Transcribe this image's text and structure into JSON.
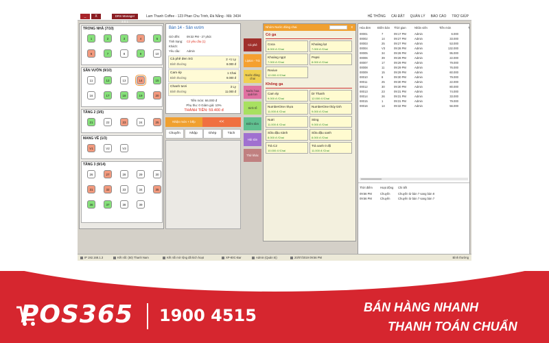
{
  "titlebar": {
    "btn1": "_",
    "btn2": "X",
    "app_title": "DRS Manager 3.0.1",
    "store": "Lam Thanh Coffee - 123 Phan Chu Trinh, Đà Nẵng - Mã: 3434"
  },
  "top_menu": [
    "HỆ THỐNG",
    "CÀI ĐẶT",
    "QUẢN LÝ",
    "BÁO CÁO",
    "TRỢ GIÚP"
  ],
  "areas": [
    {
      "title": "TRONG NHÀ  (7/10)",
      "tables": [
        {
          "n": "1",
          "c": "g"
        },
        {
          "n": "2",
          "c": "g"
        },
        {
          "n": "3",
          "c": "g"
        },
        {
          "n": "4",
          "c": "r"
        },
        {
          "n": "5",
          "c": "g"
        },
        {
          "n": "6",
          "c": "r"
        },
        {
          "n": "7",
          "c": "g"
        },
        {
          "n": "8",
          "c": ""
        },
        {
          "n": "9",
          "c": "g"
        },
        {
          "n": "10",
          "c": ""
        }
      ]
    },
    {
      "title": "SÂN VƯỜN  (9/10)",
      "tables": [
        {
          "n": "11",
          "c": ""
        },
        {
          "n": "12",
          "c": "g"
        },
        {
          "n": "13",
          "c": ""
        },
        {
          "n": "14",
          "c": "r",
          "sel": true
        },
        {
          "n": "15",
          "c": "g"
        },
        {
          "n": "16",
          "c": ""
        },
        {
          "n": "17",
          "c": "g"
        },
        {
          "n": "18",
          "c": "g"
        },
        {
          "n": "19",
          "c": "g"
        },
        {
          "n": "20",
          "c": "r"
        }
      ]
    },
    {
      "title": "TẦNG 2  (3/5)",
      "tables": [
        {
          "n": "21",
          "c": "g"
        },
        {
          "n": "22",
          "c": ""
        },
        {
          "n": "23",
          "c": "r"
        },
        {
          "n": "24",
          "c": ""
        },
        {
          "n": "25",
          "c": "r"
        }
      ]
    },
    {
      "title": "MANG VỀ  (1/3)",
      "tables": [
        {
          "n": "V1",
          "c": "r"
        },
        {
          "n": "V2",
          "c": ""
        },
        {
          "n": "V3",
          "c": ""
        }
      ]
    },
    {
      "title": "TẦNG 3  (9/14)",
      "tables": [
        {
          "n": "26",
          "c": ""
        },
        {
          "n": "27",
          "c": "r"
        },
        {
          "n": "28",
          "c": ""
        },
        {
          "n": "29",
          "c": ""
        },
        {
          "n": "30",
          "c": ""
        },
        {
          "n": "31",
          "c": "r"
        },
        {
          "n": "32",
          "c": "r"
        },
        {
          "n": "33",
          "c": ""
        },
        {
          "n": "34",
          "c": ""
        },
        {
          "n": "35",
          "c": "r"
        },
        {
          "n": "36",
          "c": "g"
        },
        {
          "n": "37",
          "c": "g"
        },
        {
          "n": "38",
          "c": ""
        },
        {
          "n": "39",
          "c": ""
        }
      ]
    }
  ],
  "info": {
    "title": "Bàn 14 - Sân vườn",
    "rows": [
      {
        "k": "Giờ đến:",
        "v": "09:32 PM  -  27 phút"
      },
      {
        "k": "Tình trạng:",
        "v": "Có yêu cầu (1)"
      },
      {
        "k": "Khách:",
        "v": ""
      },
      {
        "k": "Yêu cầu:",
        "v": "Admin"
      }
    ],
    "orders": [
      {
        "name": "Cà phê đen SG",
        "qty": "2 +1 Ly",
        "status": "Bình thường",
        "price": "8.000 đ"
      },
      {
        "name": "Cam ép",
        "qty": "1 Chai",
        "status": "Bình thường",
        "price": "9.000 đ"
      },
      {
        "name": "Chanh tươi",
        "qty": "3 Ly",
        "status": "Bình thường",
        "price": "11.000 đ"
      }
    ],
    "tien_mon": "Tiền món: 66.000 đ",
    "phu_thu": "Phụ thu: 0    Giảm giá: 10%",
    "thanh_tien": "THÀNH TIỀN: 59.400 đ",
    "send_label": "Nhận món + bếp",
    "back_label": "<<",
    "actions": [
      "Chuyển",
      "Nhập",
      "Ghép",
      "Tách"
    ]
  },
  "categories": [
    {
      "label": "Cà phê",
      "bg": "#a0302c",
      "fg": "#ffffff"
    },
    {
      "label": "Lipton - Trà",
      "bg": "#f5a030",
      "fg": "#ffffff"
    },
    {
      "label": "Nước đóng chai",
      "bg": "#f0d050",
      "fg": "#333333"
    },
    {
      "label": "Nước hoa quả lon",
      "bg": "#e070a0",
      "fg": "#333333"
    },
    {
      "label": "Sinh tố",
      "bg": "#a8e060",
      "fg": "#333333"
    },
    {
      "label": "Điểm tâm",
      "bg": "#60c090",
      "fg": "#333333"
    },
    {
      "label": "Hải sản",
      "bg": "#a070d0",
      "fg": "#ffffff"
    },
    {
      "label": "Thứ khác",
      "bg": "#c08080",
      "fg": "#ffffff"
    }
  ],
  "menu": {
    "header": "Nhóm Nước đóng chai",
    "close": "x",
    "sections": [
      {
        "title": "Có ga",
        "items": [
          {
            "name": "Coca",
            "price": "8.000 đ /Chai"
          },
          {
            "name": "Khoáng lạt",
            "price": "7.000 đ /Chai"
          },
          {
            "name": "Khoáng ngọt",
            "price": "7.000 đ /Chai"
          },
          {
            "name": "Pepsi",
            "price": "8.000 đ /Chai"
          },
          {
            "name": "Revive",
            "price": "12.000 đ /Chai"
          }
        ]
      },
      {
        "title": "Không ga",
        "items": [
          {
            "name": "Cam ép",
            "price": "9.000 đ /Chai"
          },
          {
            "name": "Dr Thanh",
            "price": "12.000 đ /Chai"
          },
          {
            "name": "NumberOne nhựa",
            "price": "11.000 đ /Chai"
          },
          {
            "name": "NumberOne thủy tinh",
            "price": "9.000 đ /Chai"
          },
          {
            "name": "Nutri",
            "price": "11.000 đ /Chai"
          },
          {
            "name": "Sting",
            "price": "9.000 đ /Chai"
          },
          {
            "name": "Sữa đậu nành",
            "price": "8.000 đ /Chai"
          },
          {
            "name": "Sữa đậu xanh",
            "price": "8.000 đ /Chai"
          },
          {
            "name": "Trà C2",
            "price": "10.000 đ /Chai"
          },
          {
            "name": "Trà xanh 0 độ",
            "price": "11.000 đ /Chai"
          }
        ]
      }
    ]
  },
  "invoices": {
    "headers": [
      "Hóa đơn",
      "Điểm bán",
      "Thời gian",
      "Nhân viên",
      "Tiền món",
      "T"
    ],
    "rows": [
      [
        "00001",
        "7",
        "09:17 PM",
        "Admin",
        "6.000"
      ],
      [
        "00002",
        "14",
        "09:27 PM",
        "Admin",
        "33.000"
      ],
      [
        "00003",
        "25",
        "09:27 PM",
        "Admin",
        "53.000"
      ],
      [
        "00004",
        "V3",
        "09:28 PM",
        "Admin",
        "132.000"
      ],
      [
        "00005",
        "34",
        "09:28 PM",
        "Admin",
        "95.000"
      ],
      [
        "00006",
        "39",
        "09:28 PM",
        "Admin",
        "22.000"
      ],
      [
        "00007",
        "17",
        "09:29 PM",
        "Admin",
        "79.000"
      ],
      [
        "00008",
        "11",
        "09:29 PM",
        "Admin",
        "76.000"
      ],
      [
        "00009",
        "15",
        "09:29 PM",
        "Admin",
        "60.000"
      ],
      [
        "00010",
        "8",
        "09:30 PM",
        "Admin",
        "79.000"
      ],
      [
        "00011",
        "25",
        "09:30 PM",
        "Admin",
        "22.000"
      ],
      [
        "00012",
        "30",
        "09:30 PM",
        "Admin",
        "80.000"
      ],
      [
        "00013",
        "23",
        "09:31 PM",
        "Admin",
        "74.000"
      ],
      [
        "00014",
        "26",
        "09:31 PM",
        "Admin",
        "33.000"
      ],
      [
        "00015",
        "1",
        "09:31 PM",
        "Admin",
        "79.000"
      ],
      [
        "00016",
        "14",
        "09:32 PM",
        "Admin",
        "56.000"
      ]
    ]
  },
  "activity": {
    "headers": [
      "Thời điểm",
      "Hoạt động",
      "Chi tiết"
    ],
    "rows": [
      [
        "09:56 PM",
        "Chuyển",
        "Chuyển từ bàn 7 sang bàn 8"
      ],
      [
        "09:56 PM",
        "Chuyển",
        "Chuyển từ bàn 7 sang bàn 7"
      ]
    ]
  },
  "status": {
    "ip": "IP 192.168.1.3",
    "conn": "Kết nối: (50) Thanh Nam",
    "ext": "Kết nối mở rộng đã kích hoạt",
    "printer": "XP-80C-Bar",
    "user": "Admin (Quản trị)",
    "date": "20/07/2019 09:56 PM",
    "mode": "Bình thường"
  },
  "banner": {
    "logo": "POS365",
    "phone": "1900 4515",
    "slogan1": "BÁN HÀNG NHANH",
    "slogan2": "THANH TOÁN CHUẨN"
  }
}
